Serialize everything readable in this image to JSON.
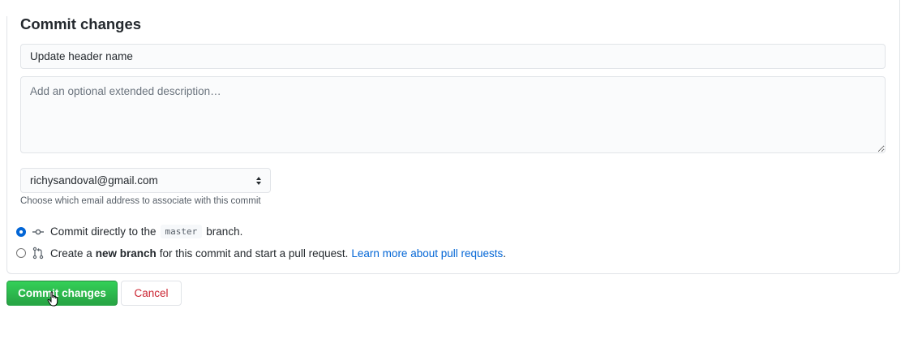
{
  "form": {
    "title": "Commit changes",
    "summary_value": "Update header name",
    "description_placeholder": "Add an optional extended description…",
    "email_selected": "richysandoval@gmail.com",
    "email_note": "Choose which email address to associate with this commit"
  },
  "options": {
    "direct": {
      "prefix": "Commit directly to the",
      "branch": "master",
      "suffix": "branch.",
      "icon": "git-commit-icon",
      "checked": true
    },
    "new_branch": {
      "prefix": "Create a",
      "bold": "new branch",
      "suffix": "for this commit and start a pull request.",
      "link": "Learn more about pull requests",
      "link_suffix": ".",
      "icon": "git-pull-request-icon",
      "checked": false
    }
  },
  "buttons": {
    "commit_label": "Commit changes",
    "cancel_label": "Cancel"
  },
  "colors": {
    "primary_green": "#2ea44f",
    "cancel_red": "#cb2431",
    "link_blue": "#0366d6"
  }
}
